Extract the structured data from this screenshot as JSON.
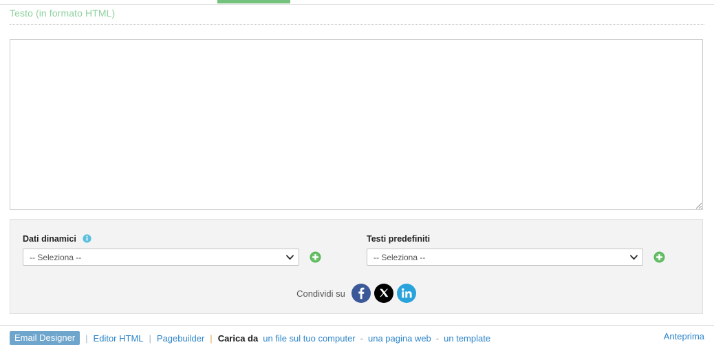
{
  "tabs": {
    "active_indicator": true,
    "accent_color": "#74c27d"
  },
  "section": {
    "title": "Testo (in formato HTML)",
    "title_color": "#8fd19e"
  },
  "editor": {
    "name": "html-source-textarea",
    "value": "",
    "placeholder": ""
  },
  "panel": {
    "dynamic_data": {
      "label": "Dati dinamici",
      "info_icon": "info-icon",
      "select_value": "-- Seleziona --",
      "add_button": "add-dynamic-data-button"
    },
    "predefined_texts": {
      "label": "Testi predefiniti",
      "select_value": "-- Seleziona --",
      "add_button": "add-predefined-text-button"
    },
    "share": {
      "label": "Condividi su",
      "networks": [
        {
          "name": "facebook",
          "color": "#3b5998",
          "glyph": "f"
        },
        {
          "name": "x-twitter",
          "color": "#000000",
          "glyph": "X"
        },
        {
          "name": "linkedin",
          "color": "#29a3dc",
          "glyph": "in"
        }
      ]
    }
  },
  "bottom_bar": {
    "designer_label": "Email Designer",
    "sep1": "|",
    "editor_html_label": "Editor HTML",
    "sep2": "|",
    "pagebuilder_label": "Pagebuilder",
    "sep3": "|",
    "upload_from_label": "Carica da",
    "upload_file_label": "un file sul tuo computer",
    "dash1": "-",
    "upload_web_label": "una pagina web",
    "dash2": "-",
    "upload_template_label": "un template",
    "preview_label": "Anteprima"
  }
}
